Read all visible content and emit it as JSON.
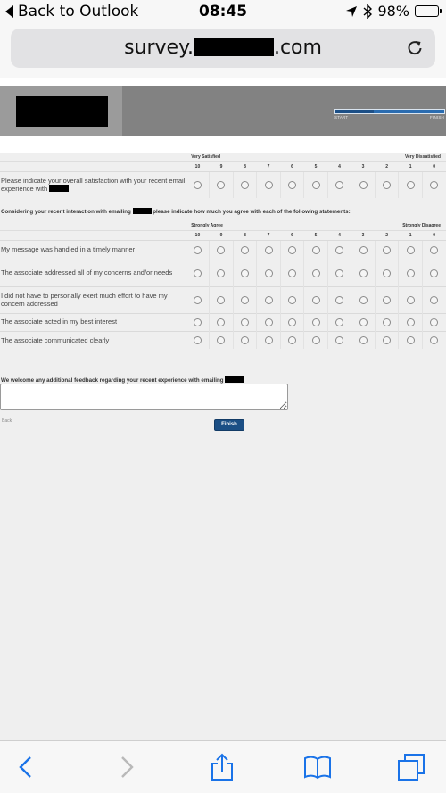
{
  "status_bar": {
    "back_label": "Back to Outlook",
    "time": "08:45",
    "battery": "98%"
  },
  "browser": {
    "url_prefix": "survey.",
    "url_suffix": ".com"
  },
  "banner": {
    "progress_start": "START",
    "progress_finish": "FINISH",
    "progress_fraction": 0.35
  },
  "q1": {
    "scale_left": "Very Satisfied",
    "scale_right": "Very Dissatisfied",
    "scale_numbers": [
      "10",
      "9",
      "8",
      "7",
      "6",
      "5",
      "4",
      "3",
      "2",
      "1",
      "0"
    ],
    "question_text": "Please indicate your overall satisfaction with your recent email experience with"
  },
  "q2": {
    "title_before": "Considering your recent interaction with emailing",
    "title_after": "please indicate how much you agree with each of the following statements:",
    "scale_left": "Strongly Agree",
    "scale_right": "Strongly Disagree",
    "scale_numbers": [
      "10",
      "9",
      "8",
      "7",
      "6",
      "5",
      "4",
      "3",
      "2",
      "1",
      "0"
    ],
    "statements": [
      "My message was handled in a timely manner",
      "The associate addressed all of my concerns and/or needs",
      "I did not have to personally exert much effort to have my concern addressed",
      "The associate acted in my best interest",
      "The associate communicated clearly"
    ]
  },
  "feedback": {
    "title": "We welcome any additional feedback regarding your recent experience with emailing",
    "value": ""
  },
  "nav": {
    "back_label": "Back",
    "finish_label": "Finish"
  },
  "toolbar_icons": [
    "back-icon",
    "forward-icon",
    "share-icon",
    "bookmarks-icon",
    "tabs-icon"
  ]
}
